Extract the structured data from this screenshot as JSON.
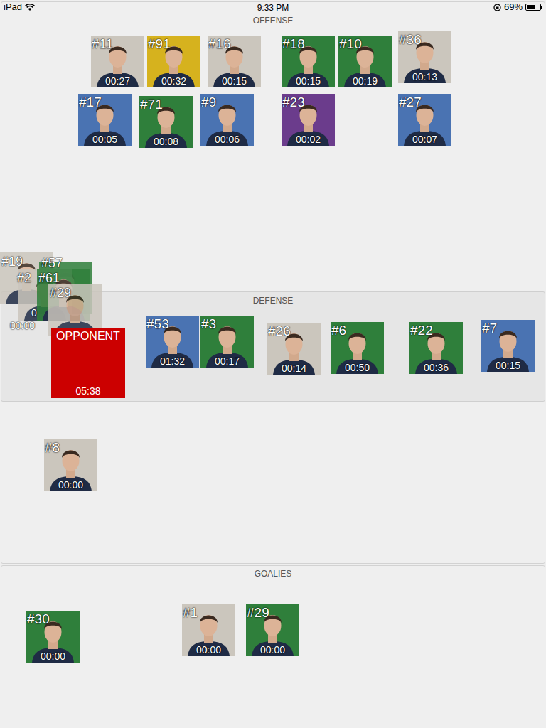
{
  "status_bar": {
    "carrier": "iPad",
    "time": "9:33 PM",
    "battery": "69%",
    "battery_level": 0.69
  },
  "sections": {
    "offense": "OFFENSE",
    "defense": "DEFENSE",
    "goalies": "GOALIES"
  },
  "offense": [
    {
      "number": "#11",
      "time": "00:27",
      "color": "#cbc6bd"
    },
    {
      "number": "#91",
      "time": "00:32",
      "color": "#d6b21e"
    },
    {
      "number": "#16",
      "time": "00:15",
      "color": "#cbc6bd"
    },
    {
      "number": "#18",
      "time": "00:15",
      "color": "#2f7f3b"
    },
    {
      "number": "#10",
      "time": "00:19",
      "color": "#2f7f3b"
    },
    {
      "number": "#36",
      "time": "00:13",
      "color": "#cbc6bd"
    },
    {
      "number": "#17",
      "time": "00:05",
      "color": "#4a73b2"
    },
    {
      "number": "#71",
      "time": "00:08",
      "color": "#2f7f3b"
    },
    {
      "number": "#9",
      "time": "00:06",
      "color": "#4a73b2"
    },
    {
      "number": "#23",
      "time": "00:02",
      "color": "#6b3c8c"
    },
    {
      "number": "#27",
      "time": "00:07",
      "color": "#4a73b2"
    }
  ],
  "defense": [
    {
      "number": "#53",
      "time": "01:32",
      "color": "#4a73b2"
    },
    {
      "number": "#3",
      "time": "00:17",
      "color": "#2f7f3b"
    },
    {
      "number": "#26",
      "time": "00:14",
      "color": "#cbc6bd"
    },
    {
      "number": "#6",
      "time": "00:50",
      "color": "#2f7f3b"
    },
    {
      "number": "#22",
      "time": "00:36",
      "color": "#2f7f3b"
    },
    {
      "number": "#7",
      "time": "00:15",
      "color": "#4a73b2"
    }
  ],
  "opponent": {
    "label": "OPPONENT",
    "time": "05:38"
  },
  "stack": [
    {
      "number": "#19",
      "time": "00:00",
      "color": "#cbc6bd"
    },
    {
      "number": "#57",
      "color": "#2f7f3b"
    },
    {
      "number": "#2",
      "time": "0",
      "color": "#cbc6bd"
    },
    {
      "number": "#61",
      "color": "#2f7f3b"
    },
    {
      "number": "#29",
      "color": "#cbc6bd"
    }
  ],
  "unassigned": [
    {
      "number": "#8",
      "time": "00:00",
      "color": "#cbc6bd"
    }
  ],
  "goalies": [
    {
      "number": "#30",
      "time": "00:00",
      "color": "#2f7f3b"
    },
    {
      "number": "#1",
      "time": "00:00",
      "color": "#cbc6bd"
    },
    {
      "number": "#29",
      "time": "00:00",
      "color": "#2f7f3b"
    }
  ]
}
